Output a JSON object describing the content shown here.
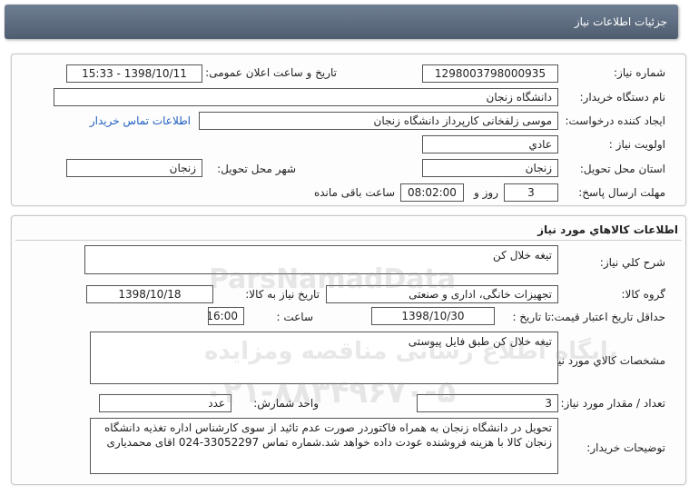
{
  "header": {
    "title": "جزئیات اطلاعات نیاز"
  },
  "need_info": {
    "need_number_label": "شماره نیاز:",
    "need_number": "1298003798000935",
    "announce_label": "تاریخ و ساعت اعلان عمومی:",
    "announce_value": "1398/10/11 - 15:33",
    "buyer_org_label": "نام دستگاه خریدار:",
    "buyer_org": "دانشگاه زنجان",
    "creator_label": "ایجاد کننده درخواست:",
    "creator": "موسی زلفخانی کارپرداز دانشگاه زنجان",
    "contact_link": "اطلاعات تماس خریدار",
    "priority_label": "اولویت نیاز :",
    "priority": "عادي",
    "province_label": "استان محل تحویل:",
    "province": "زنجان",
    "city_label": "شهر محل تحویل:",
    "city": "زنجان",
    "deadline_label": "مهلت ارسال پاسخ:",
    "deadline_days": "3",
    "days_and": "روز و",
    "deadline_time": "08:02:00",
    "remaining": "ساعت باقی مانده"
  },
  "goods": {
    "section_title": "اطلاعات کالاهاي مورد نياز",
    "summary_label": "شرح کلي نياز:",
    "summary": "تیغه خلال کن",
    "group_label": "گروه کالا:",
    "group": "تجهیزات خانگی، اداری و صنعتی",
    "need_date_label": "تاریخ نیاز به کالا:",
    "need_date": "1398/10/18",
    "min_price_label": "حداقل تاریخ اعتبار قیمت:",
    "to_date_label": "تا تاریخ :",
    "to_date": "1398/10/30",
    "time_label": "ساعت :",
    "time": "16:00",
    "specs_label": "مشخصات کالاي مورد نياز:",
    "specs": "تیغه خلال کن طبق فایل پیوستی",
    "qty_label": "تعداد / مقدار مورد نیاز:",
    "qty": "3",
    "unit_label": "واحد شمارش:",
    "unit": "عدد",
    "notes_label": "توضیحات خریدار:",
    "notes": "تحویل در دانشگاه زنجان به همراه فاکتوردر صورت عدم تائید از سوی کارشناس اداره تغذیه دانشگاه زنجان کالا با هزینه فروشنده عودت داده خواهد شد.شماره تماس 33052297-024 اقای محمدیاری"
  },
  "watermark": {
    "brand": "ParsNamadData",
    "tagline": "پایگاه اطلاع رسانی مناقصه ومزایده",
    "phone": "۰۲۱-۸۸۳۴۹۶۷۰-۵"
  }
}
